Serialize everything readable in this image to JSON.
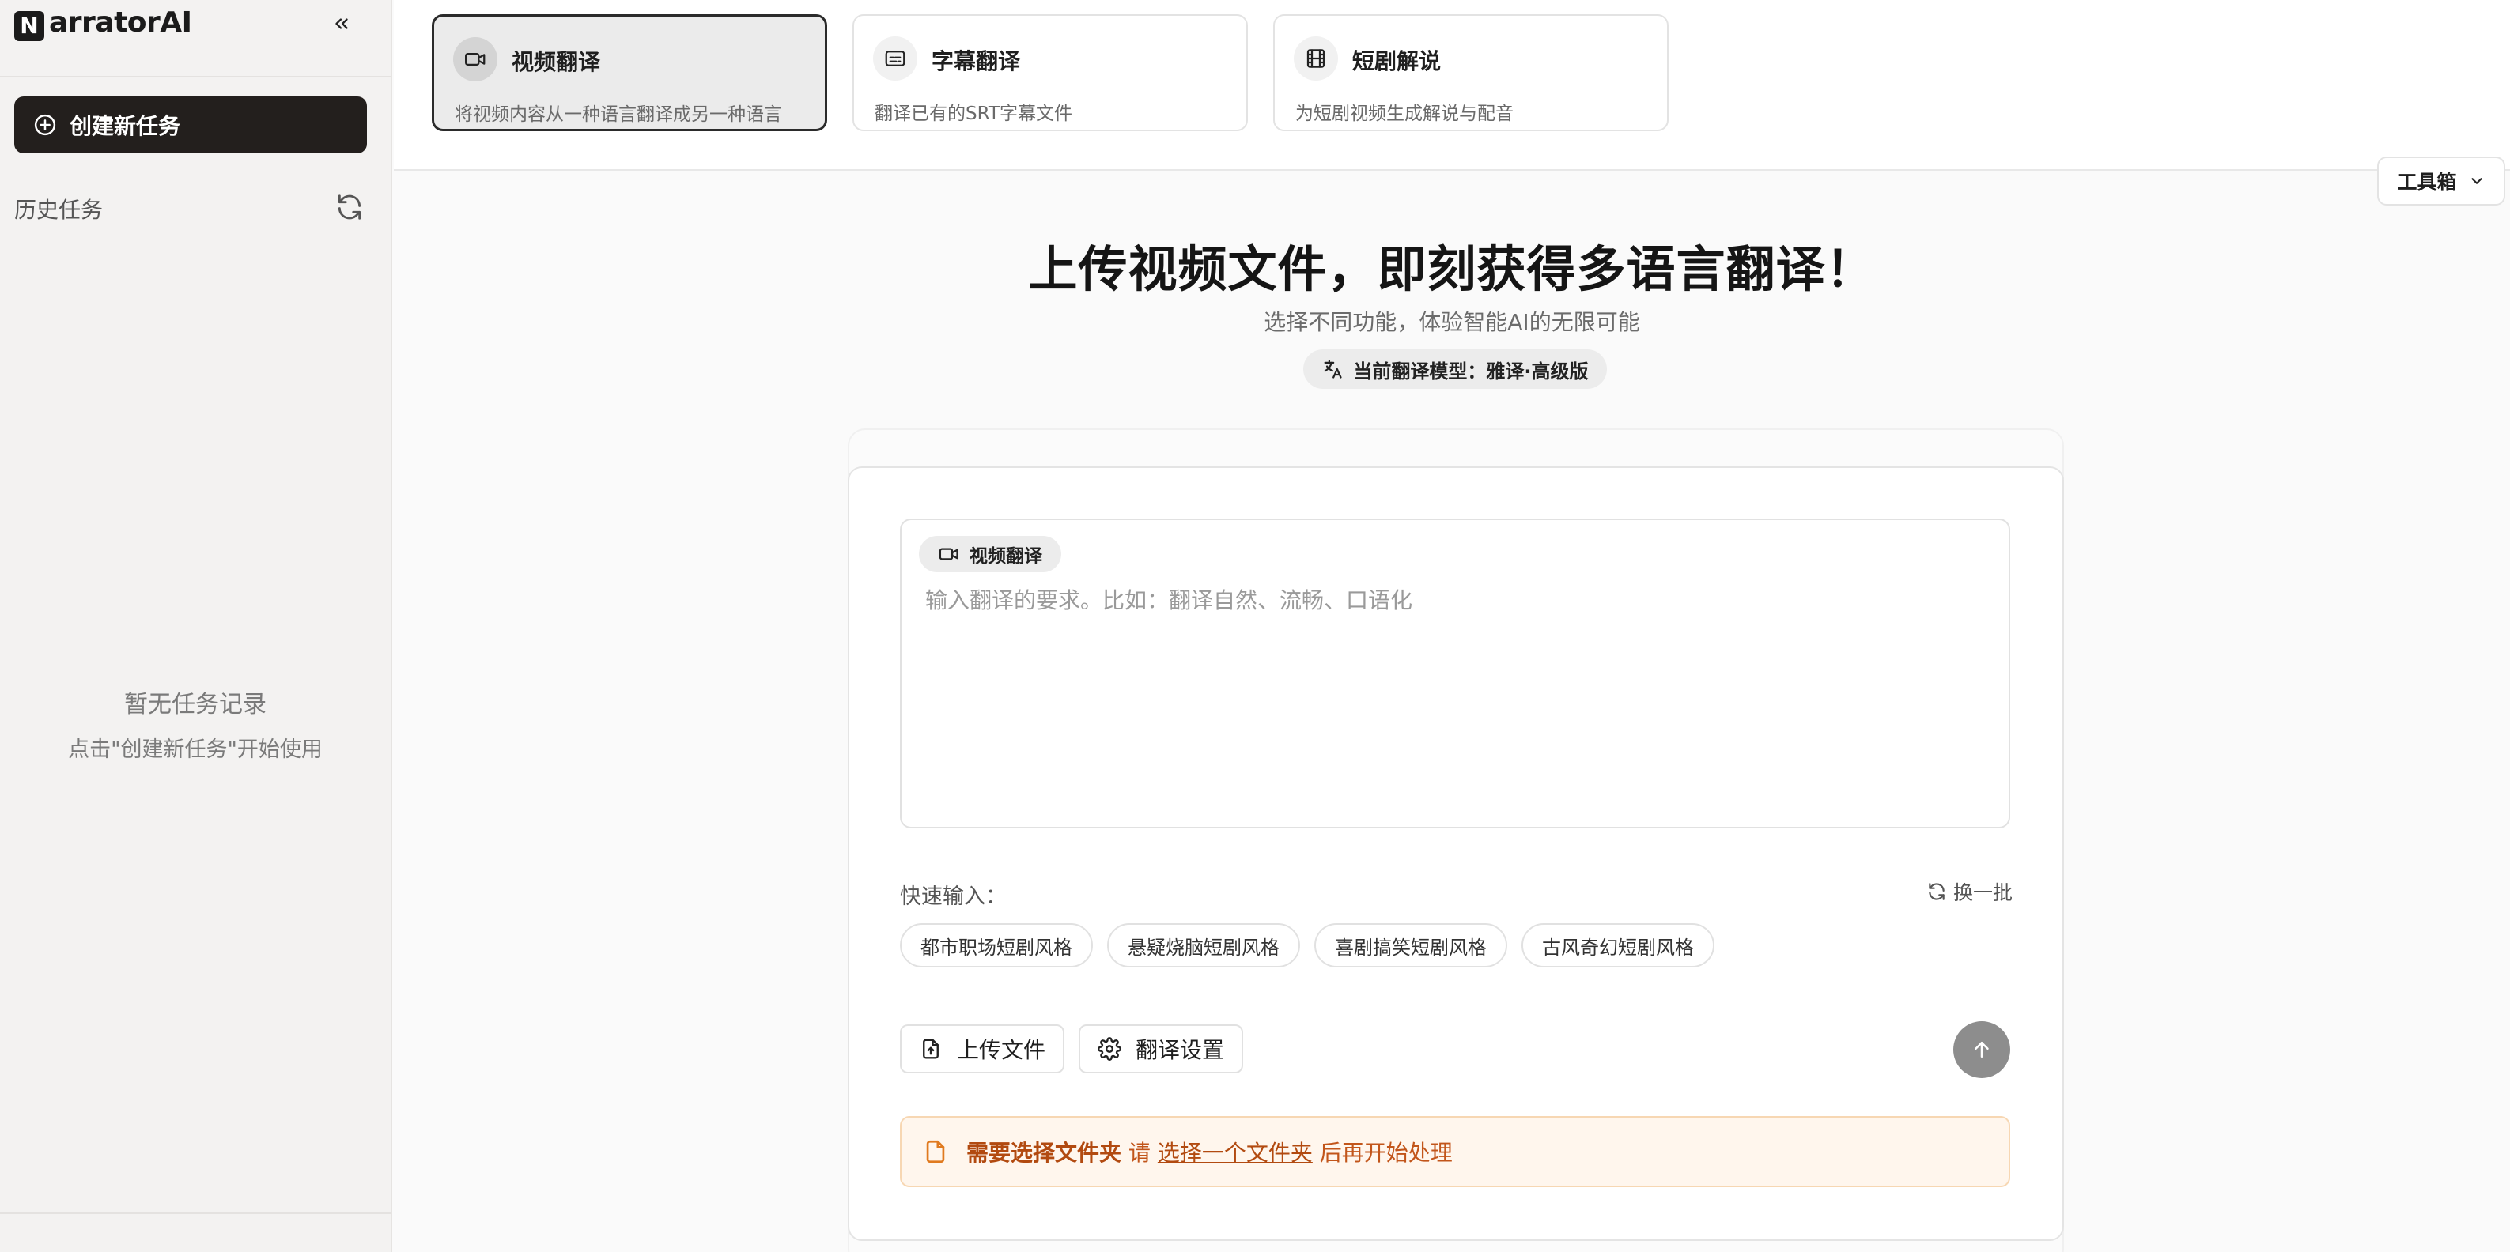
{
  "sidebar": {
    "logo_badge": "N",
    "logo_text": "arratorAI",
    "new_task_label": "创建新任务",
    "history_label": "历史任务",
    "empty_title": "暂无任务记录",
    "empty_hint": "点击\"创建新任务\"开始使用"
  },
  "function_cards": [
    {
      "title": "视频翻译",
      "desc": "将视频内容从一种语言翻译成另一种语言",
      "icon": "video-camera-icon",
      "active": true
    },
    {
      "title": "字幕翻译",
      "desc": "翻译已有的SRT字幕文件",
      "icon": "subtitles-icon",
      "active": false
    },
    {
      "title": "短剧解说",
      "desc": "为短剧视频生成解说与配音",
      "icon": "film-icon",
      "active": false
    }
  ],
  "toolbox_label": "工具箱",
  "hero": {
    "title": "上传视频文件，即刻获得多语言翻译！",
    "subtitle": "选择不同功能，体验智能AI的无限可能",
    "model_pill": "当前翻译模型：雅译·高级版"
  },
  "editor": {
    "mode_chip": "视频翻译",
    "placeholder": "输入翻译的要求。比如：翻译自然、流畅、口语化",
    "value": ""
  },
  "quick": {
    "label": "快速输入：",
    "swap_label": "换一批",
    "chips": [
      "都市职场短剧风格",
      "悬疑烧脑短剧风格",
      "喜剧搞笑短剧风格",
      "古风奇幻短剧风格"
    ]
  },
  "actions": {
    "upload_label": "上传文件",
    "settings_label": "翻译设置"
  },
  "notice": {
    "strong": "需要选择文件夹",
    "pre": "请",
    "link": "选择一个文件夹",
    "post": "后再开始处理"
  },
  "colors": {
    "primary_dark": "#231f1d",
    "notice_bg": "#fff6ed",
    "notice_text": "#b24a10",
    "send_button": "#8d8d8d"
  }
}
